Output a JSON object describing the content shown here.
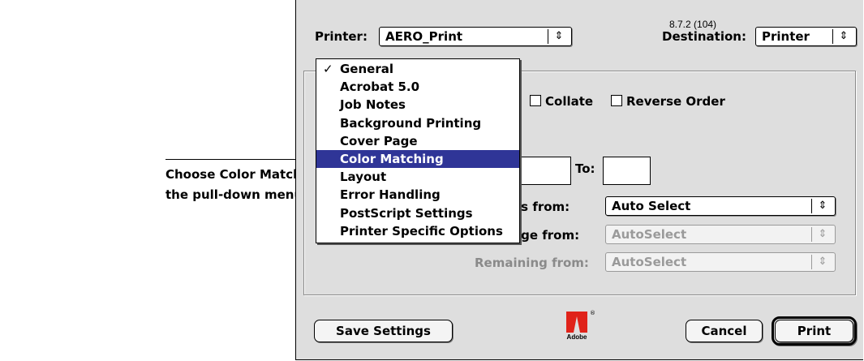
{
  "annotation": {
    "text": "Choose Color Matching from\nthe pull-down menu"
  },
  "dialog": {
    "version": "8.7.2 (104)",
    "printer_label": "Printer:",
    "printer_value": "AERO_Print",
    "destination_label": "Destination:",
    "destination_value": "Printer",
    "collate_label": "Collate",
    "reverse_order_label": "Reverse Order",
    "to_label": "To:",
    "first_page_label_partial": "es from:",
    "first_page_value": "Auto Select",
    "first_page_enabled": true,
    "remaining_partial_label": "age from:",
    "remaining_partial_value": "AutoSelect",
    "remaining_label": "Remaining from:",
    "remaining_value": "AutoSelect",
    "popup_arrow_icon": "up-down-arrows-icon",
    "save_settings_label": "Save Settings",
    "cancel_label": "Cancel",
    "print_label": "Print",
    "logo_text": "Adobe",
    "logo_color": "#e0231a"
  },
  "menu": {
    "checked_index": 0,
    "selected_index": 5,
    "selected_color": "#2f3597",
    "items": [
      {
        "label": "General",
        "check": "✓"
      },
      {
        "label": "Acrobat 5.0"
      },
      {
        "label": "Job Notes"
      },
      {
        "label": "Background Printing"
      },
      {
        "label": "Cover Page"
      },
      {
        "label": "Color Matching"
      },
      {
        "label": "Layout"
      },
      {
        "label": "Error Handling"
      },
      {
        "label": "PostScript Settings"
      },
      {
        "label": "Printer Specific Options"
      }
    ]
  }
}
